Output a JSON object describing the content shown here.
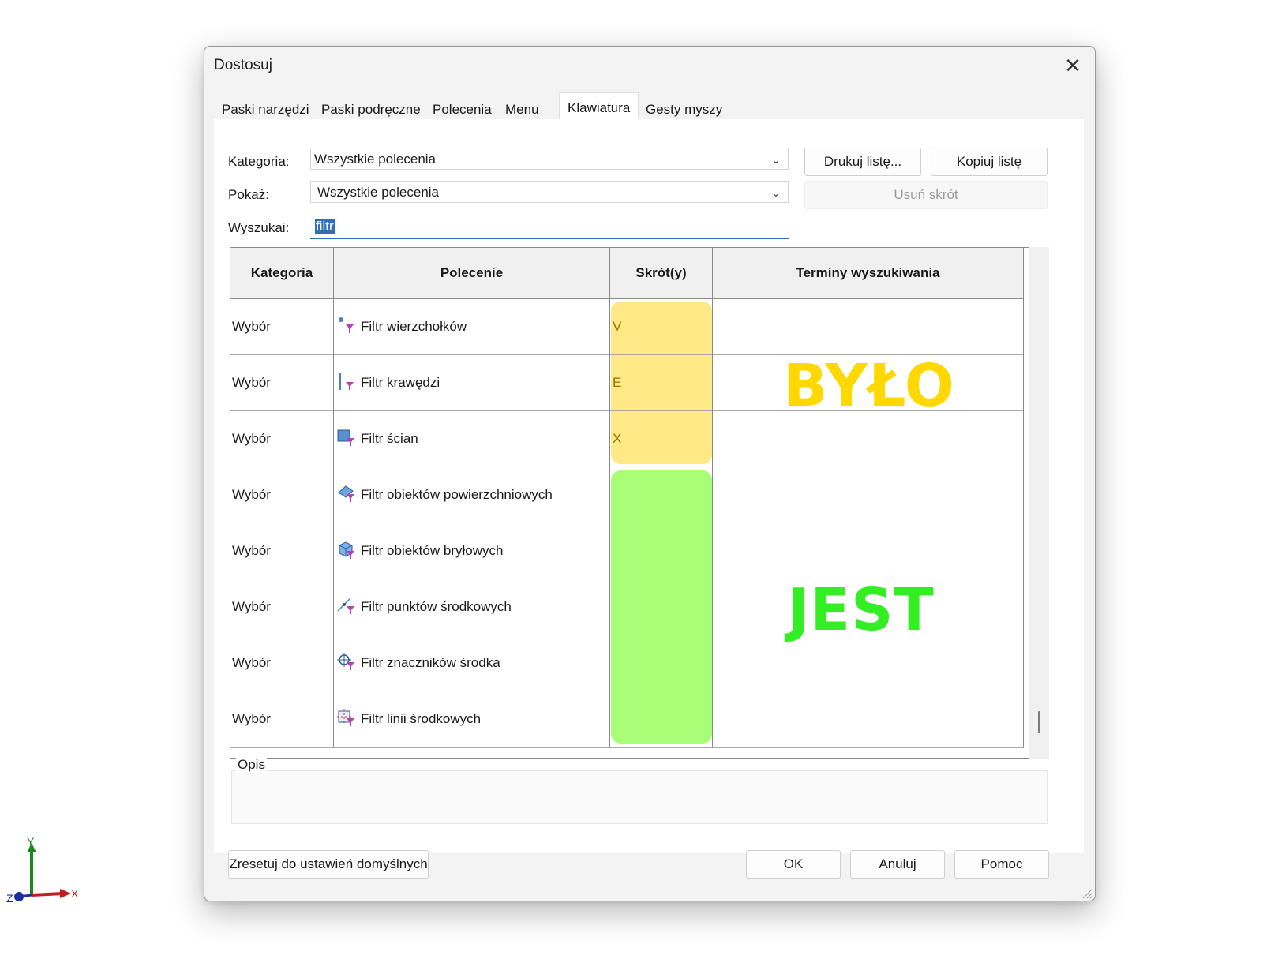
{
  "dialog": {
    "title": "Dostosuj",
    "close_glyph": "✕"
  },
  "tabs": [
    {
      "label": "Paski narzędzi"
    },
    {
      "label": "Paski podręczne"
    },
    {
      "label": "Polecenia"
    },
    {
      "label": "Menu"
    },
    {
      "label": "Klawiatura",
      "active": true
    },
    {
      "label": "Gesty myszy"
    }
  ],
  "form": {
    "category_label": "Kategoria:",
    "category_value": "Wszystkie polecenia",
    "show_label": "Pokaż:",
    "show_value": "Wszystkie polecenia",
    "search_label": "Wyszukai:",
    "search_value": "filtr"
  },
  "buttons": {
    "print": "Drukuj listę...",
    "copy": "Kopiuj listę",
    "remove": "Usuń skrót",
    "reset": "Zresetuj do ustawień domyślnych",
    "ok": "OK",
    "cancel": "Anuluj",
    "help": "Pomoc"
  },
  "table": {
    "headers": [
      "Kategoria",
      "Polecenie",
      "Skrót(y)",
      "Terminy wyszukiwania"
    ],
    "rows": [
      {
        "category": "Wybór",
        "command": "Filtr wierzchołków",
        "icon": "vertex-filter-icon",
        "shortcut": "V"
      },
      {
        "category": "Wybór",
        "command": "Filtr krawędzi",
        "icon": "edge-filter-icon",
        "shortcut": "E"
      },
      {
        "category": "Wybór",
        "command": "Filtr ścian",
        "icon": "face-filter-icon",
        "shortcut": "X"
      },
      {
        "category": "Wybór",
        "command": "Filtr obiektów powierzchniowych",
        "icon": "surface-body-filter-icon",
        "shortcut": ""
      },
      {
        "category": "Wybór",
        "command": "Filtr obiektów bryłowych",
        "icon": "solid-body-filter-icon",
        "shortcut": ""
      },
      {
        "category": "Wybór",
        "command": "Filtr punktów środkowych",
        "icon": "midpoint-filter-icon",
        "shortcut": ""
      },
      {
        "category": "Wybór",
        "command": "Filtr znaczników środka",
        "icon": "center-mark-filter-icon",
        "shortcut": ""
      },
      {
        "category": "Wybór",
        "command": "Filtr linii środkowych",
        "icon": "centerline-filter-icon",
        "shortcut": ""
      }
    ]
  },
  "annotations": {
    "before": "BYŁO",
    "after": "JEST",
    "before_color": "#ffd800",
    "after_color": "#33ee22"
  },
  "description": {
    "label": "Opis"
  },
  "triad": {
    "x": "X",
    "y": "Y",
    "z": "Z"
  },
  "colors": {
    "accent": "#2f6fb7",
    "highlight_yellow": "#ffe77f",
    "highlight_green": "#a8ff77"
  }
}
